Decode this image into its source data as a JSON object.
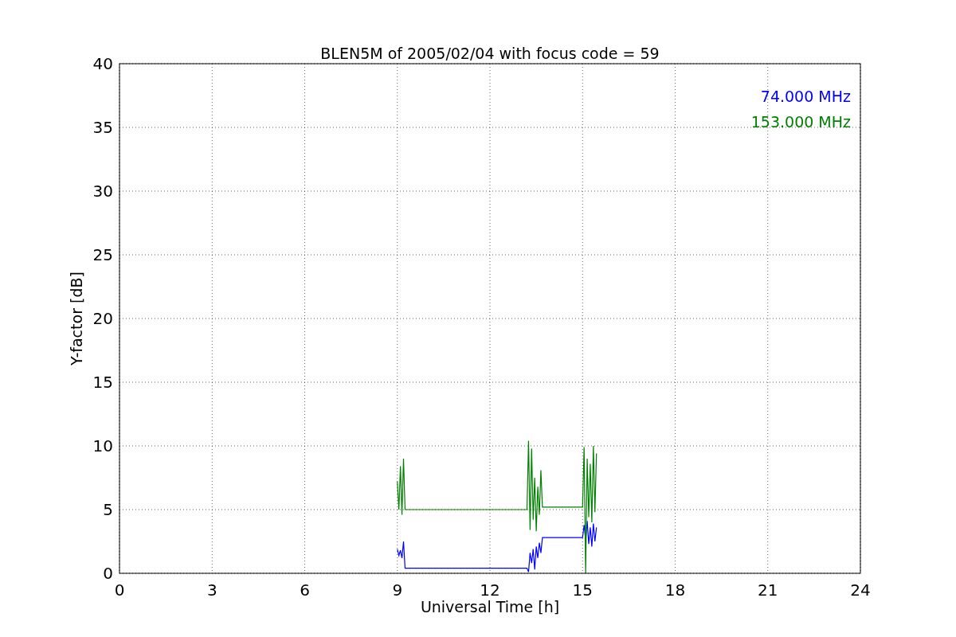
{
  "chart_data": {
    "type": "line",
    "title": "BLEN5M of 2005/02/04 with focus code = 59",
    "xlabel": "Universal Time [h]",
    "ylabel": "Y-factor [dB]",
    "x": [
      9.0,
      9.05,
      9.1,
      9.15,
      9.2,
      9.25,
      13.2,
      13.25,
      13.3,
      13.35,
      13.4,
      13.45,
      13.5,
      13.55,
      13.6,
      13.65,
      13.7,
      15.0,
      15.05,
      15.1,
      15.15,
      15.2,
      15.25,
      15.3,
      15.35,
      15.4,
      15.45
    ],
    "series": [
      {
        "name": "74.000 MHz",
        "color": "#0000ff",
        "values": [
          1.9,
          1.4,
          1.8,
          1.2,
          2.5,
          0.4,
          0.4,
          0.1,
          1.6,
          0.8,
          1.9,
          0.3,
          2.1,
          1.2,
          2.4,
          1.6,
          2.8,
          2.8,
          3.8,
          2.6,
          4.1,
          2.3,
          3.6,
          2.1,
          3.9,
          2.5,
          3.6
        ]
      },
      {
        "name": "153.000 MHz",
        "color": "#008000",
        "values": [
          7.2,
          5.0,
          8.4,
          4.6,
          9.0,
          5.0,
          5.0,
          10.4,
          3.4,
          9.8,
          4.2,
          7.5,
          3.3,
          6.8,
          4.6,
          8.1,
          5.2,
          5.2,
          9.9,
          0.0,
          9.0,
          4.4,
          8.6,
          4.0,
          10.0,
          4.8,
          9.4
        ]
      }
    ],
    "xlim": [
      0,
      24
    ],
    "ylim": [
      0,
      40
    ],
    "xticks": [
      0,
      3,
      6,
      9,
      12,
      15,
      18,
      21,
      24
    ],
    "yticks": [
      0,
      5,
      10,
      15,
      20,
      25,
      30,
      35,
      40
    ],
    "grid": true
  }
}
